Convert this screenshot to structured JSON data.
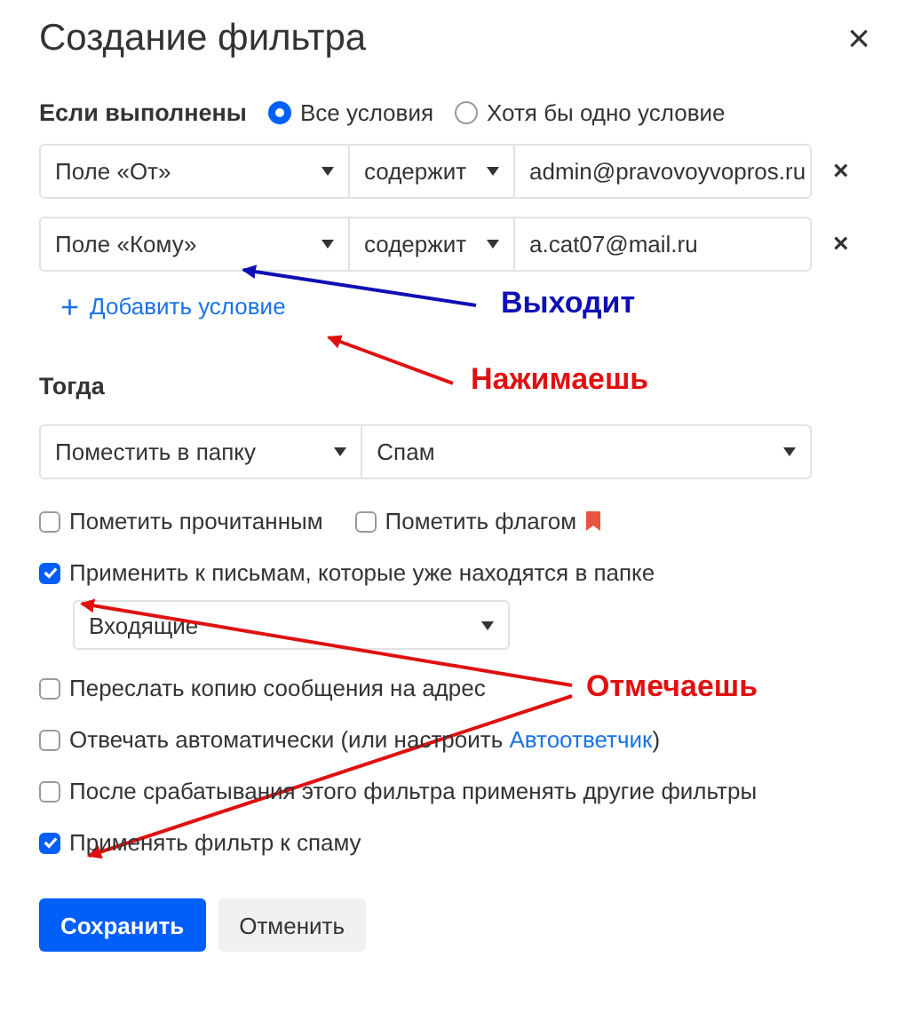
{
  "dialog": {
    "title": "Создание фильтра",
    "close": "×"
  },
  "match": {
    "label": "Если выполнены",
    "options": [
      {
        "label": "Все условия",
        "selected": true
      },
      {
        "label": "Хотя бы одно условие",
        "selected": false
      }
    ]
  },
  "conditions": [
    {
      "field": "Поле «От»",
      "operator": "содержит",
      "value": "admin@pravovoyvopros.ru",
      "remove": "×"
    },
    {
      "field": "Поле «Кому»",
      "operator": "содержит",
      "value": "a.cat07@mail.ru",
      "remove": "×"
    }
  ],
  "add_condition": {
    "icon": "+",
    "label": "Добавить условие"
  },
  "then": {
    "label": "Тогда",
    "action": "Поместить в папку",
    "folder": "Спам"
  },
  "options": [
    {
      "kind": "pair",
      "items": [
        {
          "label": "Пометить прочитанным",
          "checked": false,
          "flag": false
        },
        {
          "label": "Пометить флагом",
          "checked": false,
          "flag": true
        }
      ]
    },
    {
      "kind": "folder",
      "label": "Применить к письмам, которые уже находятся в папке",
      "checked": true,
      "folder": "Входящие"
    },
    {
      "kind": "plain",
      "label": "Переслать копию сообщения на адрес",
      "checked": false
    },
    {
      "kind": "link",
      "label": "Отвечать автоматически (или настроить ",
      "link": "Автоответчик",
      "after": ")",
      "checked": false
    },
    {
      "kind": "plain",
      "label": "После срабатывания этого фильтра применять другие фильтры",
      "checked": false
    },
    {
      "kind": "plain",
      "label": "Применять фильтр к спаму",
      "checked": true
    }
  ],
  "buttons": [
    {
      "label": "Сохранить",
      "kind": "primary"
    },
    {
      "label": "Отменить",
      "kind": "secondary"
    }
  ],
  "annotations": [
    {
      "text": "Выходит",
      "color": "#0f0fb4"
    },
    {
      "text": "Нажимаешь",
      "color": "#e01010"
    },
    {
      "text": "Отмечаешь",
      "color": "#e01010"
    }
  ]
}
